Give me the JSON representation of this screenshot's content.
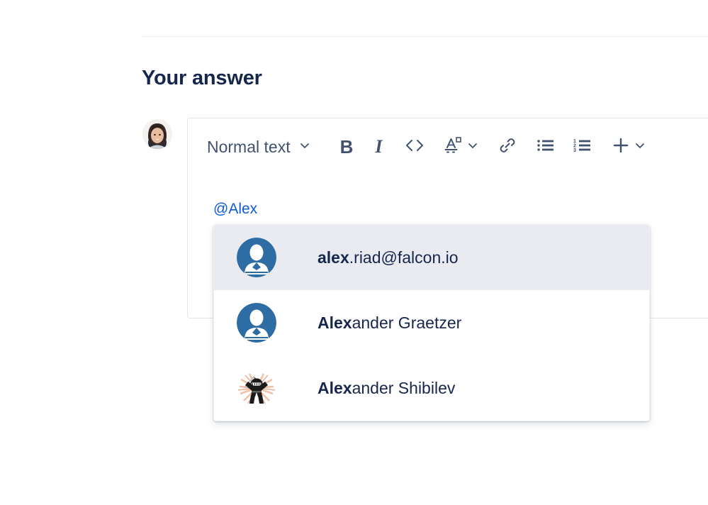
{
  "colors": {
    "text_dark": "#17264d",
    "toolbar_icon": "#42526e",
    "mention_blue": "#0b5cd5",
    "selected_row": "#e9ebf0",
    "border": "#e3e5ea",
    "divider": "#e8eaee",
    "avatar_blue": "#2e6da4"
  },
  "page": {
    "title": "Your answer"
  },
  "author": {
    "avatar_icon": "user-photo-avatar"
  },
  "toolbar": {
    "style_select": {
      "value": "Normal text",
      "chevron_icon": "chevron-down-icon"
    },
    "buttons": [
      {
        "name": "bold-button",
        "icon": "bold-icon",
        "label": "B"
      },
      {
        "name": "italic-button",
        "icon": "italic-icon",
        "label": "I"
      },
      {
        "name": "code-button",
        "icon": "code-icon",
        "label": "<>"
      },
      {
        "name": "text-color-button",
        "icon": "text-color-icon",
        "label": "A"
      },
      {
        "name": "link-button",
        "icon": "link-icon",
        "label": ""
      },
      {
        "name": "bullet-list-button",
        "icon": "bullet-list-icon",
        "label": ""
      },
      {
        "name": "numbered-list-button",
        "icon": "numbered-list-icon",
        "label": ""
      },
      {
        "name": "insert-button",
        "icon": "plus-icon",
        "label": "+"
      }
    ]
  },
  "editor": {
    "content": "@Alex"
  },
  "mention_menu": {
    "items": [
      {
        "bold_part": "alex",
        "rest_part": ".riad@falcon.io",
        "avatar_icon": "default-person-avatar",
        "selected": true
      },
      {
        "bold_part": "Alex",
        "rest_part": "ander Graetzer",
        "avatar_icon": "default-person-avatar",
        "selected": false
      },
      {
        "bold_part": "Alex",
        "rest_part": "ander Shibilev",
        "avatar_icon": "ninja-avatar",
        "selected": false
      }
    ]
  }
}
